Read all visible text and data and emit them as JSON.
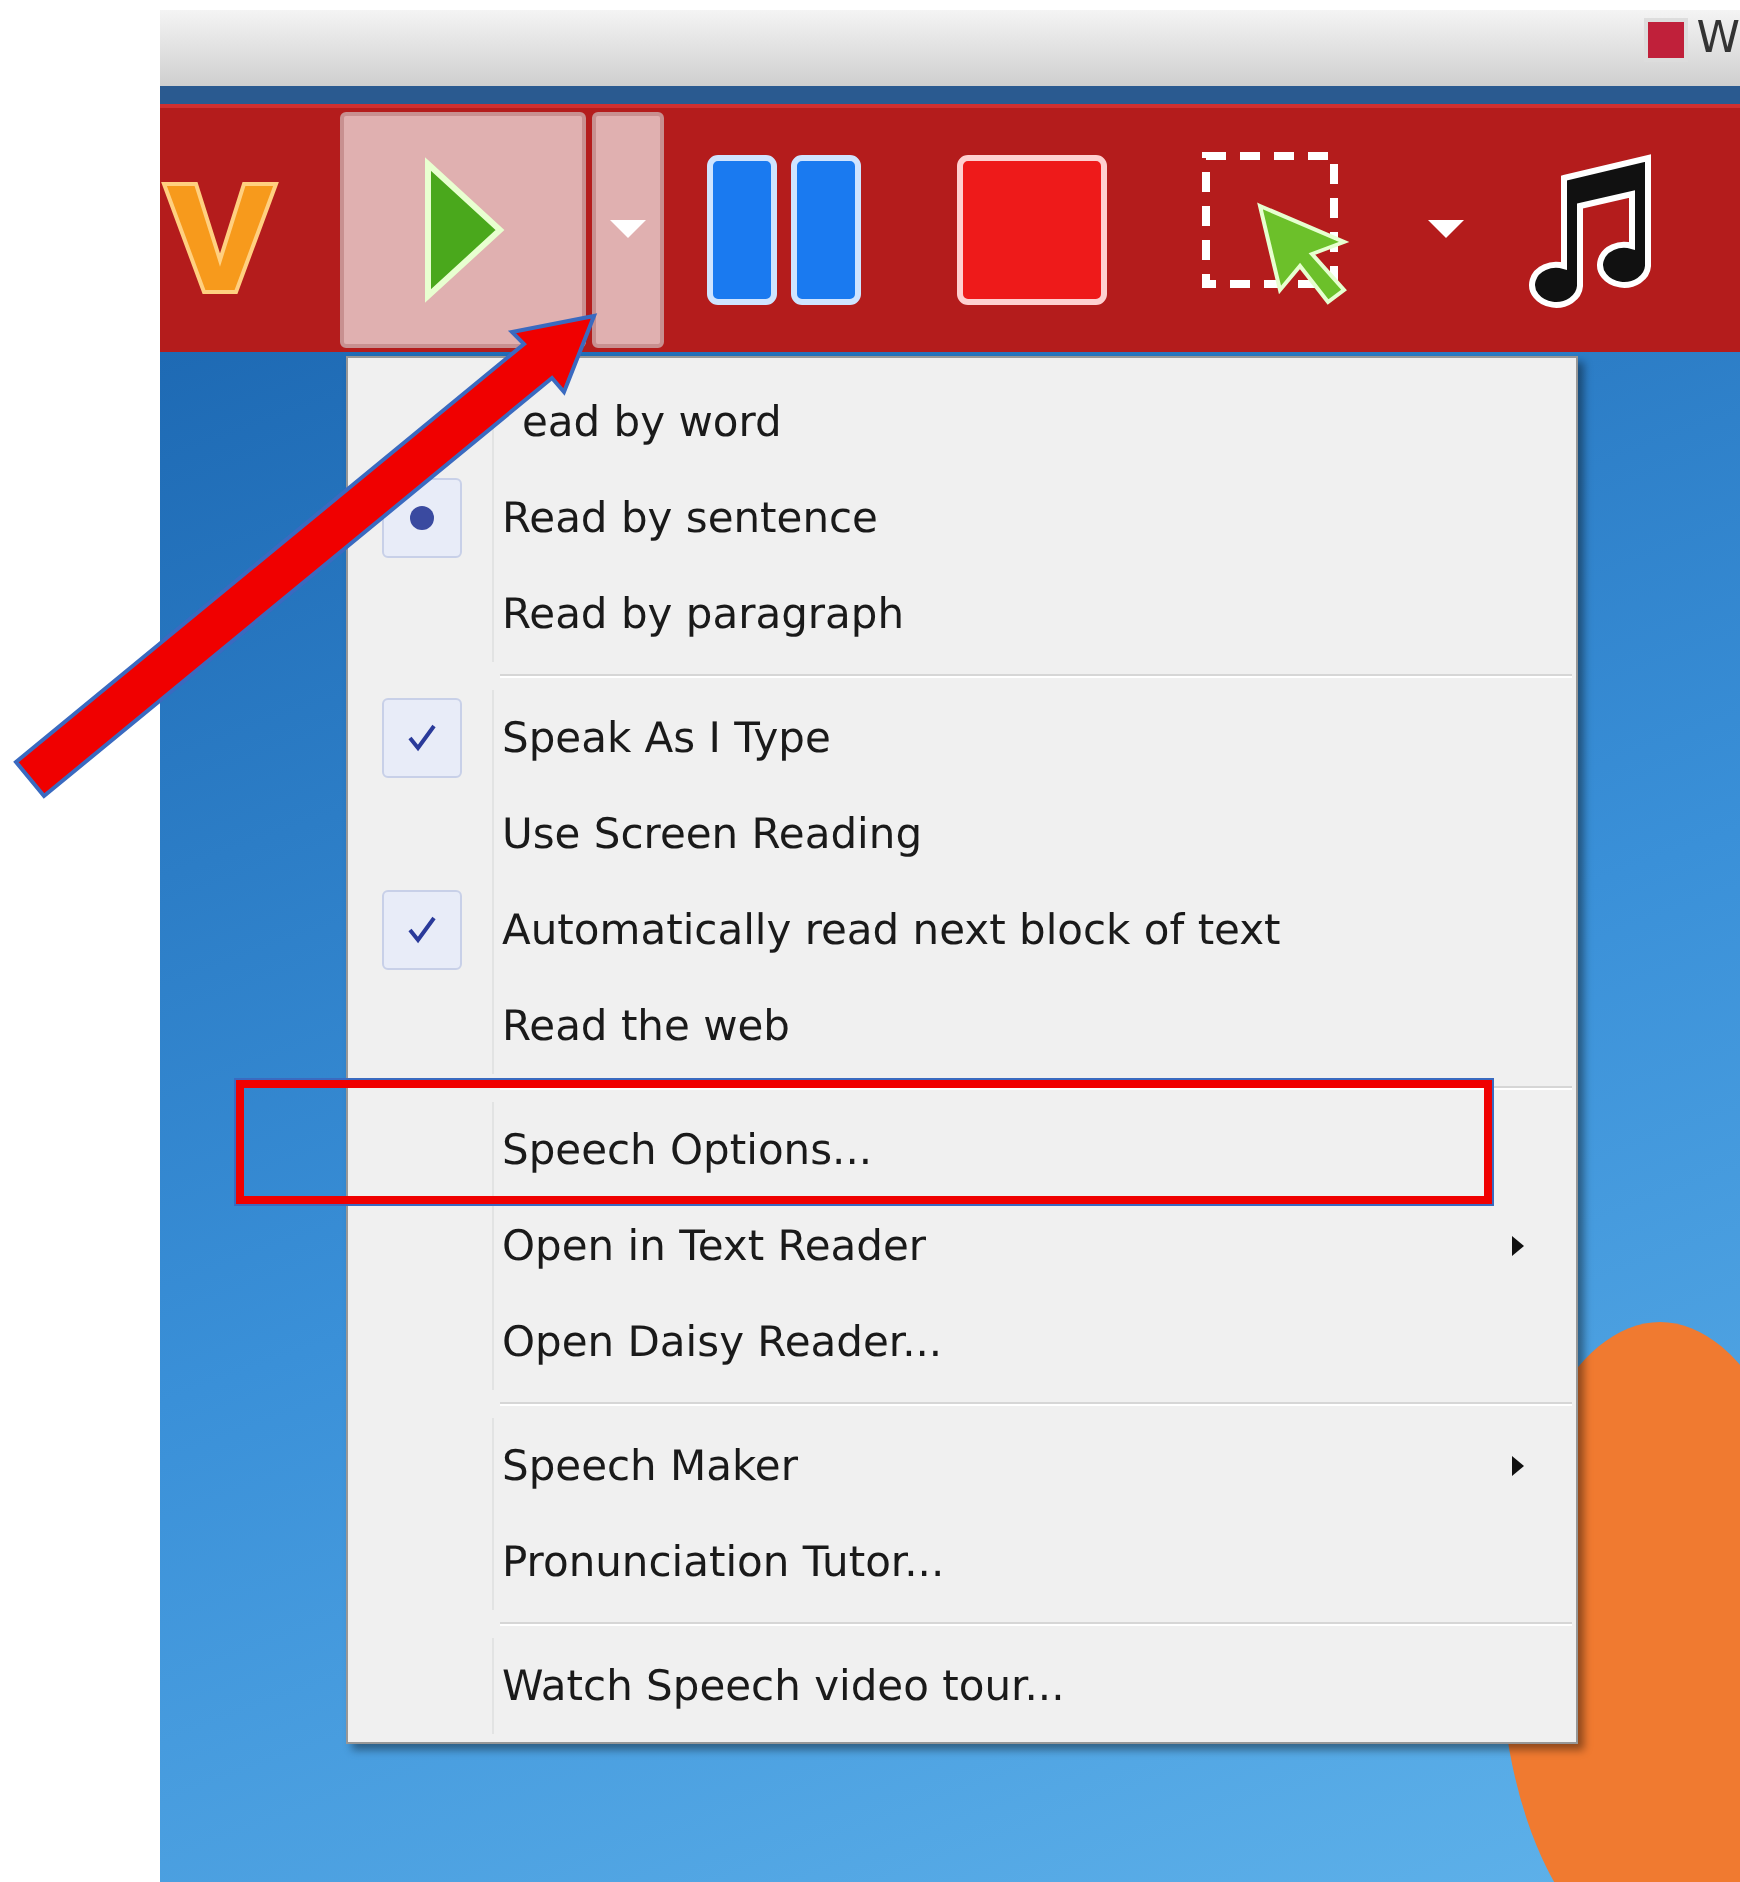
{
  "titlebar": {
    "title": "W"
  },
  "toolbar": {
    "buttons": [
      {
        "kind": "logo",
        "pressed": false
      },
      {
        "kind": "play",
        "pressed": true
      },
      {
        "kind": "dropdown",
        "pressed": true
      },
      {
        "kind": "pause",
        "pressed": false
      },
      {
        "kind": "stop",
        "pressed": false
      },
      {
        "kind": "select",
        "pressed": false
      },
      {
        "kind": "caret",
        "pressed": false
      },
      {
        "kind": "music",
        "pressed": false
      }
    ]
  },
  "menu": {
    "sections": [
      [
        {
          "kind": "radio",
          "label": "ead by word",
          "selected": false
        },
        {
          "kind": "radio",
          "label": "Read by sentence",
          "selected": true
        },
        {
          "kind": "radio",
          "label": "Read by paragraph",
          "selected": false
        }
      ],
      [
        {
          "kind": "check",
          "label": "Speak As I Type",
          "checked": true
        },
        {
          "kind": "check",
          "label": "Use Screen Reading",
          "checked": false
        },
        {
          "kind": "check",
          "label": "Automatically read next block of text",
          "checked": true
        },
        {
          "kind": "check",
          "label": "Read the web",
          "checked": false
        }
      ],
      [
        {
          "kind": "item",
          "label": "Speech Options...",
          "highlighted": true
        },
        {
          "kind": "submenu",
          "label": "Open in Text Reader"
        },
        {
          "kind": "item",
          "label": "Open Daisy Reader..."
        }
      ],
      [
        {
          "kind": "submenu",
          "label": "Speech Maker"
        },
        {
          "kind": "item",
          "label": "Pronunciation Tutor..."
        }
      ],
      [
        {
          "kind": "item",
          "label": "Watch Speech video tour..."
        }
      ]
    ]
  },
  "annotations": {
    "arrow": true
  }
}
